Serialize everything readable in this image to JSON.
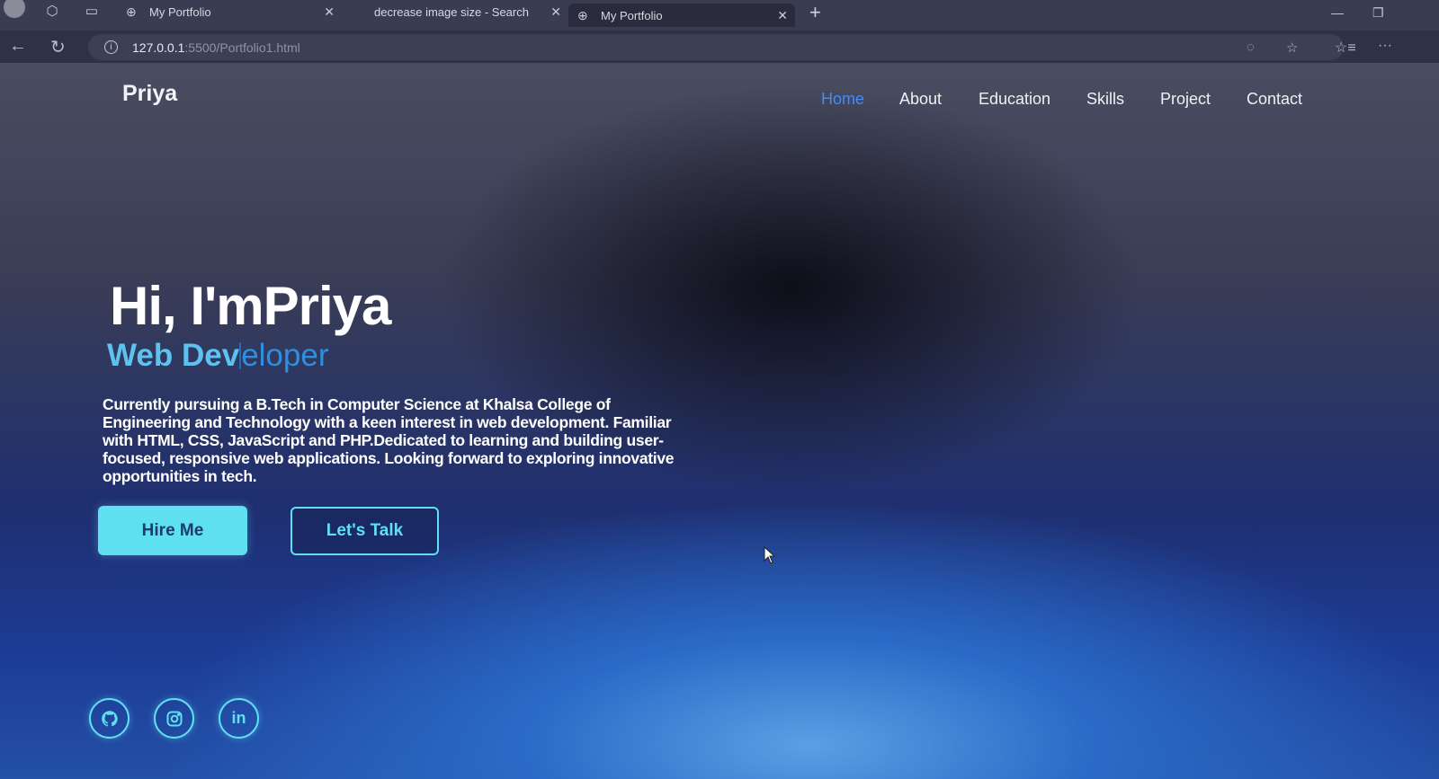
{
  "browser": {
    "tabs": [
      {
        "title": "My Portfolio",
        "active": false
      },
      {
        "title": "decrease image size - Search",
        "active": false
      },
      {
        "title": "My Portfolio",
        "active": true
      }
    ],
    "url_host": "127.0.0.1",
    "url_path": ":5500/Portfolio1.html"
  },
  "site": {
    "logo": "Priya",
    "nav": [
      "Home",
      "About",
      "Education",
      "Skills",
      "Project",
      "Contact"
    ],
    "active_nav": "Home"
  },
  "hero": {
    "title": "Hi, I'mPriya",
    "subtitle_typed": "Web Dev",
    "subtitle_rest": "eloper",
    "description": "Currently pursuing a B.Tech in Computer Science at Khalsa College of Engineering and Technology with a keen interest in web development. Familiar with HTML, CSS, JavaScript and PHP.Dedicated to learning and building user-focused, responsive web applications. Looking forward to exploring innovative opportunities in tech.",
    "hire_button": "Hire Me",
    "talk_button": "Let's Talk"
  },
  "social": [
    "github-icon",
    "instagram-icon",
    "linkedin-icon"
  ],
  "colors": {
    "accent": "#5fe0f0",
    "nav_active": "#3f8cff",
    "subtitle": "#5dc2f0"
  }
}
